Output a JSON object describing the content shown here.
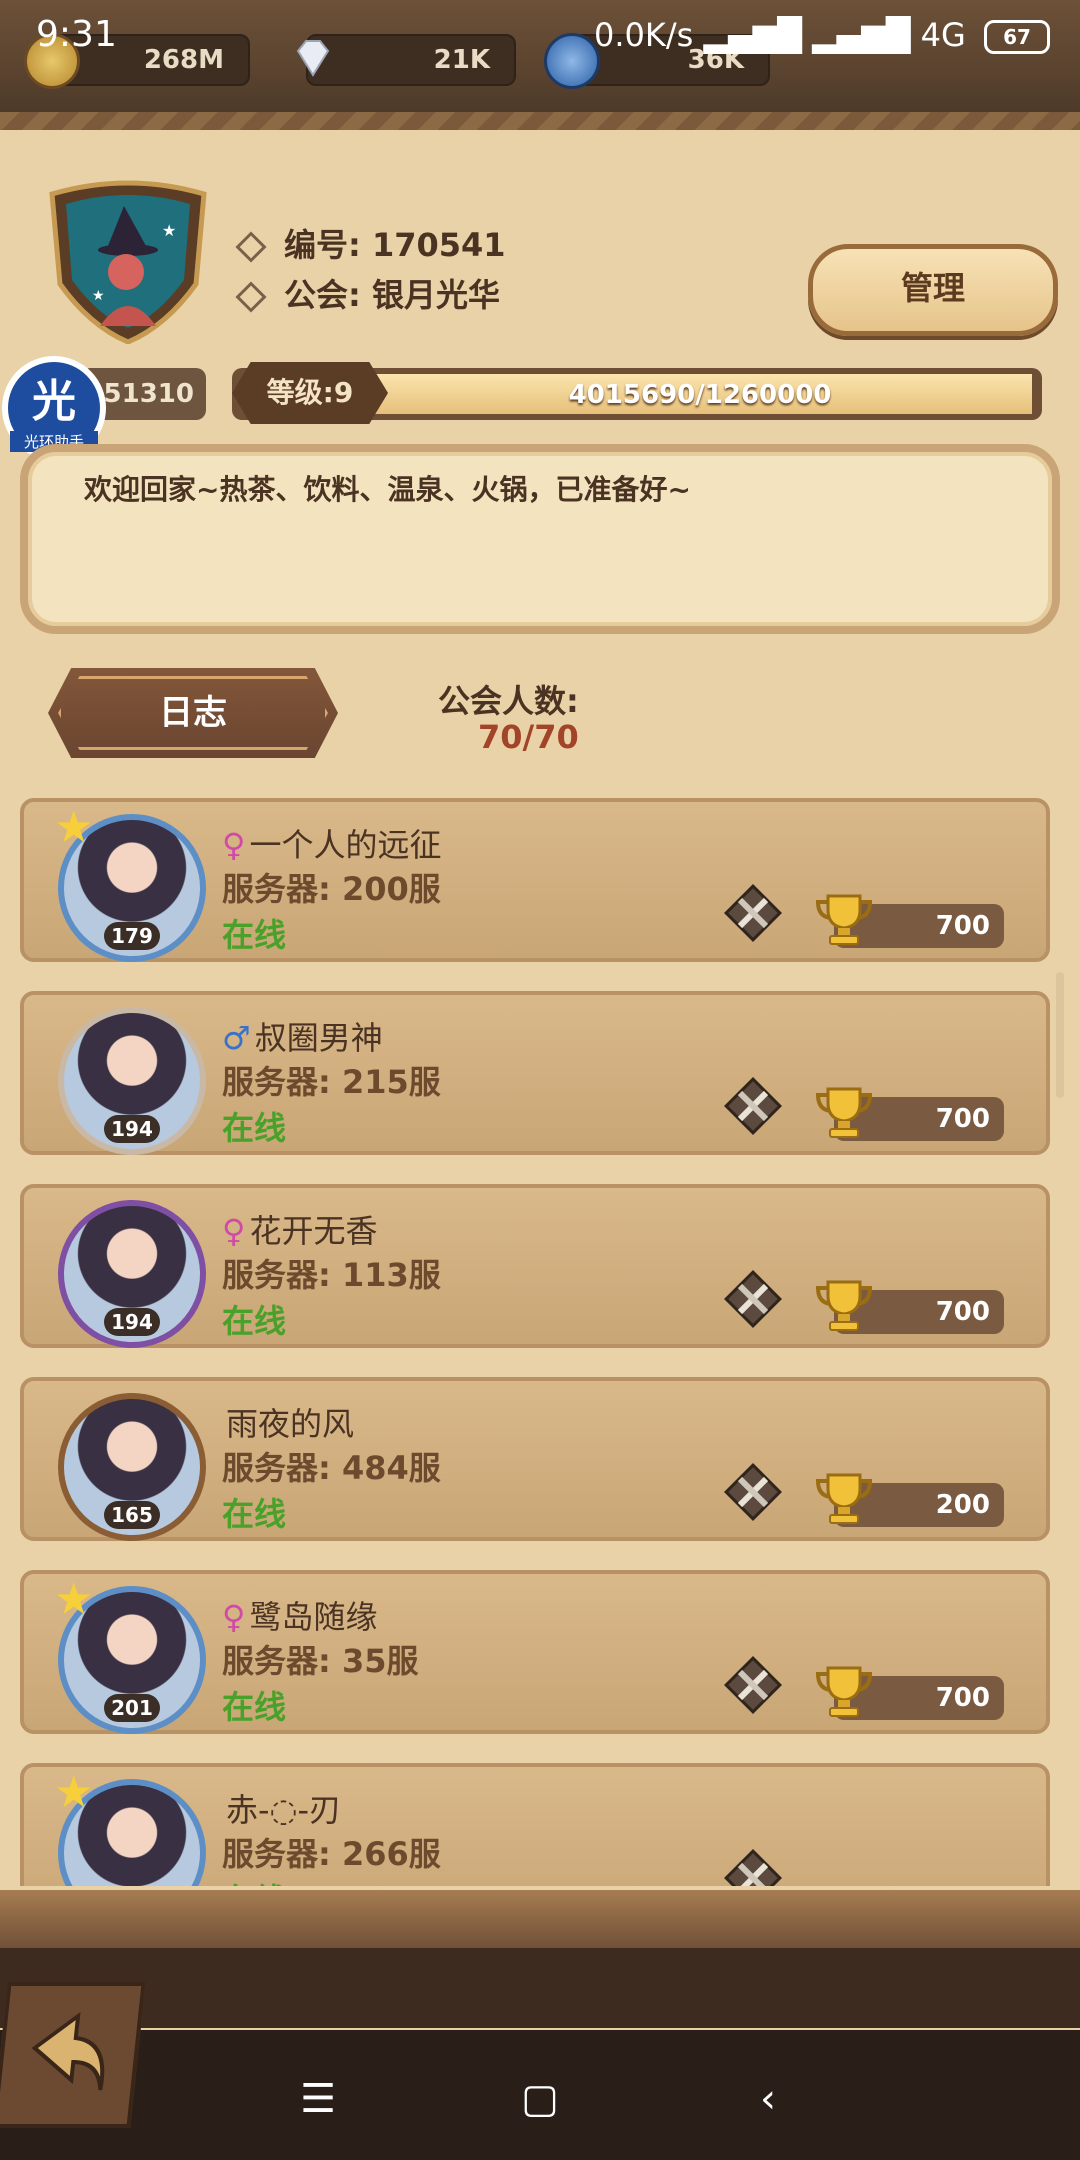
{
  "status": {
    "time": "9:31",
    "network": "0.0K/s",
    "signal_label": "4G",
    "battery": "67"
  },
  "currencies": [
    {
      "icon": "gold-coin-icon",
      "value": "268M"
    },
    {
      "icon": "diamond-icon",
      "value": "21K"
    },
    {
      "icon": "blue-orb-icon",
      "value": "36K"
    }
  ],
  "guild": {
    "id_line": "编号: 170541",
    "name_line": "公会: 银月光华",
    "manage_label": "管理",
    "exp_value": "51310",
    "level_label": "等级:9",
    "level_progress_text": "4015690/1260000",
    "level_progress_fraction": 1.0,
    "motto": "欢迎回家~热茶、饮料、温泉、火锅，已准备好~",
    "log_label": "日志",
    "members_label": "公会人数:",
    "members_count": "70/70"
  },
  "helper_logo": {
    "glyph": "光",
    "text": "光环助手"
  },
  "members": [
    {
      "name": "一个人的远征",
      "gender": "♀",
      "gender_color": "#d04aa8",
      "server": "服务器: 200服",
      "status": "在线",
      "level": "179",
      "trophies": "700",
      "star": true,
      "frame": "#5d8fc6"
    },
    {
      "name": "叔圈男神",
      "gender": "♂",
      "gender_color": "#3a72c8",
      "server": "服务器: 215服",
      "status": "在线",
      "level": "194",
      "trophies": "700",
      "star": false,
      "frame": "#c9b8a4"
    },
    {
      "name": "花开无香",
      "gender": "♀",
      "gender_color": "#d04aa8",
      "server": "服务器: 113服",
      "status": "在线",
      "level": "194",
      "trophies": "700",
      "star": false,
      "frame": "#7e4fa3"
    },
    {
      "name": "雨夜的风",
      "gender": "",
      "gender_color": "#d04aa8",
      "server": "服务器: 484服",
      "status": "在线",
      "level": "165",
      "trophies": "200",
      "star": false,
      "frame": "#8a5d35"
    },
    {
      "name": "鹭岛随缘",
      "gender": "♀",
      "gender_color": "#d04aa8",
      "server": "服务器: 35服",
      "status": "在线",
      "level": "201",
      "trophies": "700",
      "star": true,
      "frame": "#5d8fc6"
    },
    {
      "name": "赤-◌-刃",
      "gender": "",
      "gender_color": "#d04aa8",
      "server": "服务器: 266服",
      "status": "在线",
      "level": "",
      "trophies": "",
      "star": true,
      "frame": "#5d8fc6"
    }
  ],
  "nav": {
    "menu": "☰",
    "home": "▢",
    "back": "‹"
  }
}
